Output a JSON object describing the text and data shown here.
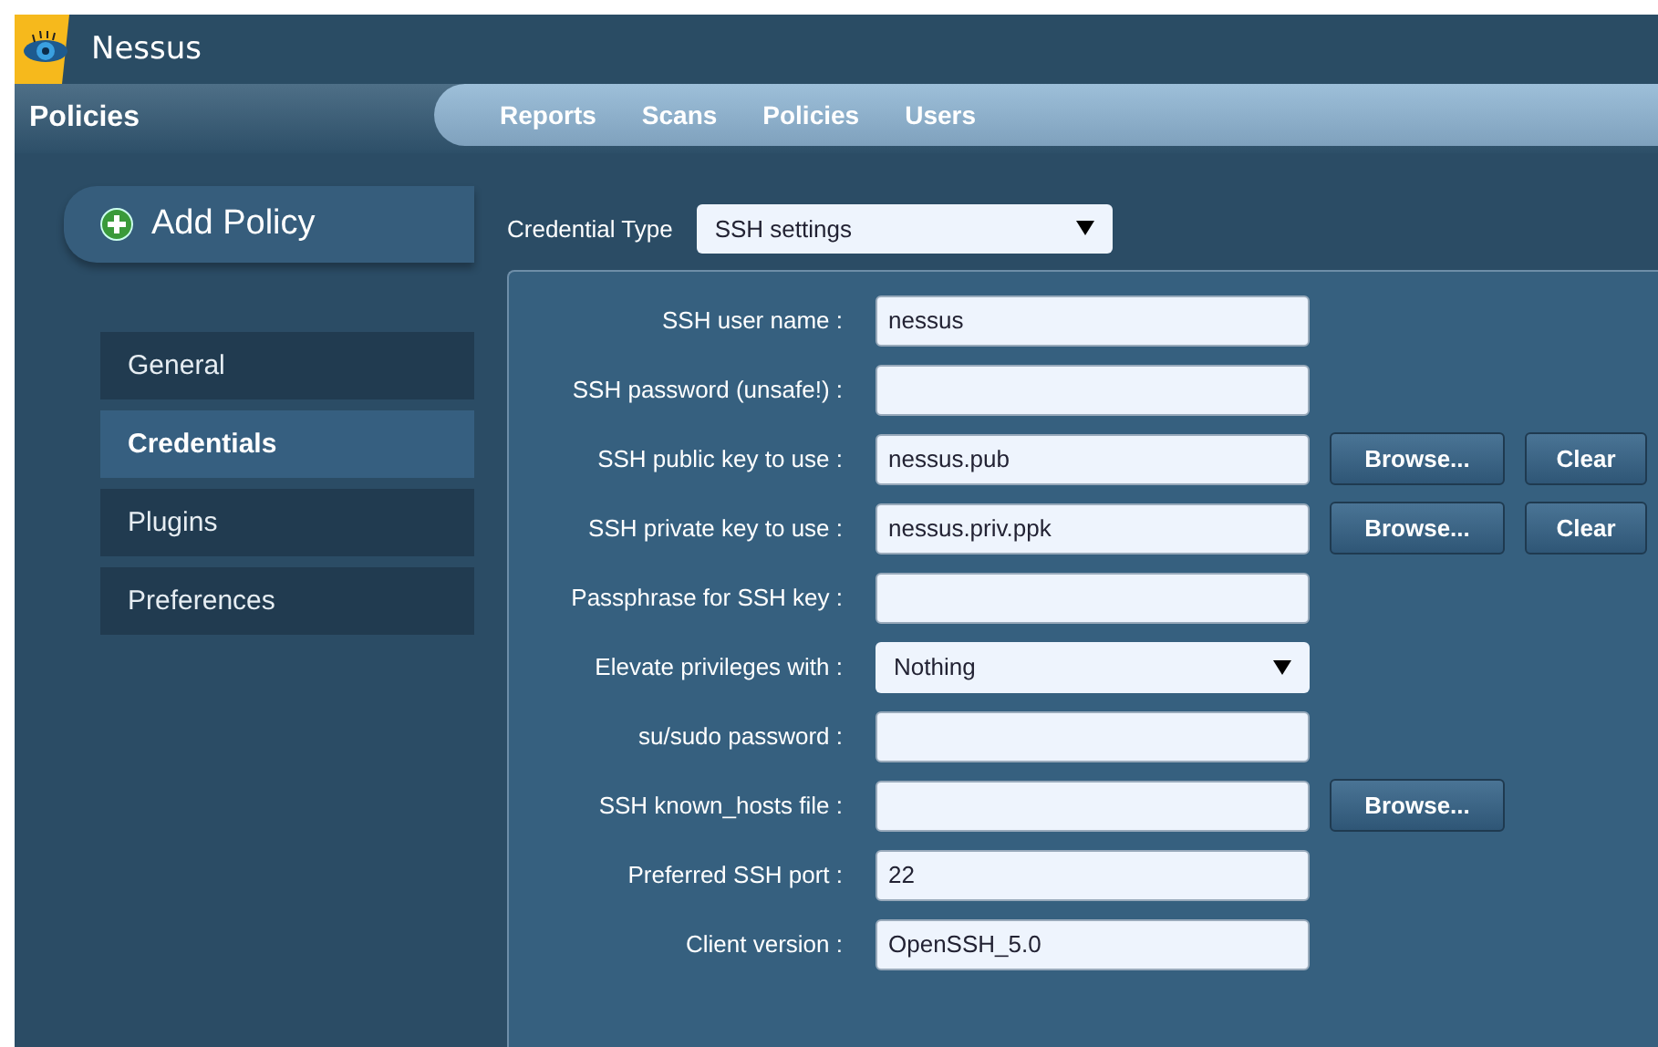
{
  "header": {
    "brand": "Nessus"
  },
  "section_title": "Policies",
  "nav": [
    {
      "label": "Reports",
      "selected": false
    },
    {
      "label": "Scans",
      "selected": false
    },
    {
      "label": "Policies",
      "selected": false
    },
    {
      "label": "Users",
      "selected": false
    }
  ],
  "add_policy": {
    "label": "Add Policy"
  },
  "sidebar": {
    "items": [
      {
        "label": "General",
        "selected": false
      },
      {
        "label": "Credentials",
        "selected": true
      },
      {
        "label": "Plugins",
        "selected": false
      },
      {
        "label": "Preferences",
        "selected": false
      }
    ]
  },
  "credential_type": {
    "label": "Credential Type",
    "value": "SSH settings"
  },
  "fields": [
    {
      "label": "SSH user name :",
      "kind": "text",
      "value": "nessus"
    },
    {
      "label": "SSH password (unsafe!) :",
      "kind": "text"
    },
    {
      "label": "SSH public key to use :",
      "kind": "text",
      "value": "nessus.pub",
      "buttons": [
        "Browse...",
        "Clear"
      ]
    },
    {
      "label": "SSH private key to use :",
      "kind": "text",
      "value": "nessus.priv.ppk",
      "buttons": [
        "Browse...",
        "Clear"
      ]
    },
    {
      "label": "Passphrase for SSH key :",
      "kind": "text"
    },
    {
      "label": "Elevate privileges with :",
      "kind": "select",
      "value": "Nothing"
    },
    {
      "label": "su/sudo password :",
      "kind": "text"
    },
    {
      "label": "SSH known_hosts file :",
      "kind": "text",
      "buttons": [
        "Browse..."
      ]
    },
    {
      "label": "Preferred SSH port :",
      "kind": "text",
      "value": "22"
    },
    {
      "label": "Client version :",
      "kind": "text",
      "value": "OpenSSH_5.0"
    }
  ]
}
